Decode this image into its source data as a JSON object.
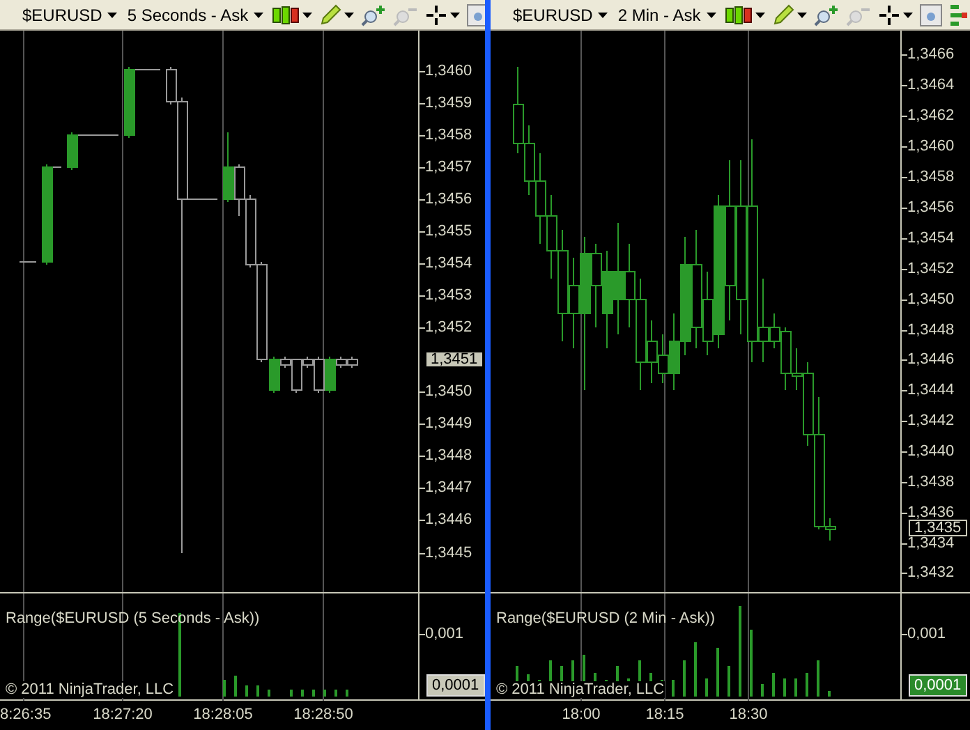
{
  "panes": [
    {
      "toolbar": {
        "instrument": "$EURUSD",
        "period": "5 Seconds - Ask",
        "tools": [
          {
            "kind": "chart-style"
          },
          {
            "kind": "drawing"
          },
          {
            "kind": "zoom-in"
          },
          {
            "kind": "zoom-out"
          },
          {
            "kind": "crosshair"
          },
          {
            "kind": "properties"
          }
        ]
      },
      "price_axis": [
        "1,3460",
        "1,3459",
        "1,3458",
        "1,3457",
        "1,3456",
        "1,3455",
        "1,3454",
        "1,3453",
        "1,3452",
        "1,3450",
        "1,3449",
        "1,3448",
        "1,3447",
        "1,3446",
        "1,3445"
      ],
      "last_price": {
        "value": "1,3451",
        "kind": "filled"
      },
      "indicator": {
        "title": "Range($EURUSD (5 Seconds - Ask))",
        "tick": "0,001",
        "last_value": "0,0001",
        "color": "#c8c8b8",
        "copyright": "© 2011 NinjaTrader, LLC"
      },
      "time_axis": [
        "8:26:35",
        "18:27:20",
        "18:28:05",
        "18:28:50"
      ]
    },
    {
      "toolbar": {
        "instrument": "$EURUSD",
        "period": "2 Min - Ask",
        "tools": [
          {
            "kind": "chart-style"
          },
          {
            "kind": "drawing"
          },
          {
            "kind": "zoom-in"
          },
          {
            "kind": "zoom-out"
          },
          {
            "kind": "crosshair"
          },
          {
            "kind": "properties"
          },
          {
            "kind": "panel"
          }
        ]
      },
      "price_axis": [
        "1,3466",
        "1,3464",
        "1,3462",
        "1,3460",
        "1,3458",
        "1,3456",
        "1,3454",
        "1,3452",
        "1,3450",
        "1,3448",
        "1,3446",
        "1,3444",
        "1,3442",
        "1,3440",
        "1,3438",
        "1,3436",
        "1,3434",
        "1,3432"
      ],
      "last_price": {
        "value": "1,3435",
        "kind": "outlined"
      },
      "indicator": {
        "title": "Range($EURUSD (2 Min - Ask))",
        "tick": "0,001",
        "last_value": "0,0001",
        "color": "#2a8a2a",
        "copyright": "© 2011 NinjaTrader, LLC"
      },
      "time_axis": [
        "18:00",
        "18:15",
        "18:30"
      ]
    }
  ]
}
